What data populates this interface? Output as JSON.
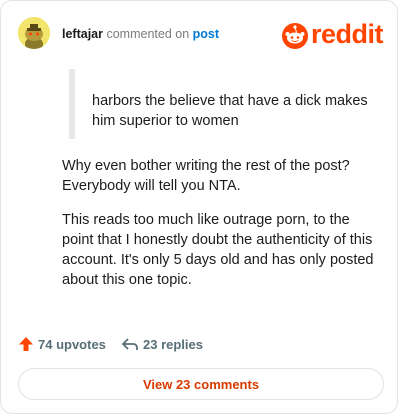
{
  "header": {
    "username": "leftajar",
    "action": "commented on",
    "link_text": "post",
    "logo_text": "reddit",
    "brand_color": "#ff4500",
    "link_color": "#0079d3"
  },
  "comment": {
    "quote": "harbors the believe that have a dick makes him superior to women",
    "paragraphs": [
      "Why even bother writing the rest of the post? Everybody will tell you NTA.",
      "This reads too much like outrage porn, to the point that I honestly doubt the authenticity of this account. It's only 5 days old and has only posted about this one topic."
    ]
  },
  "footer": {
    "upvotes": "74 upvotes",
    "replies": "23 replies",
    "upvote_icon": "upvote-arrow-icon",
    "reply_icon": "reply-arrow-icon",
    "view_button": "View 23 comments",
    "button_text_color": "#d93a00"
  }
}
